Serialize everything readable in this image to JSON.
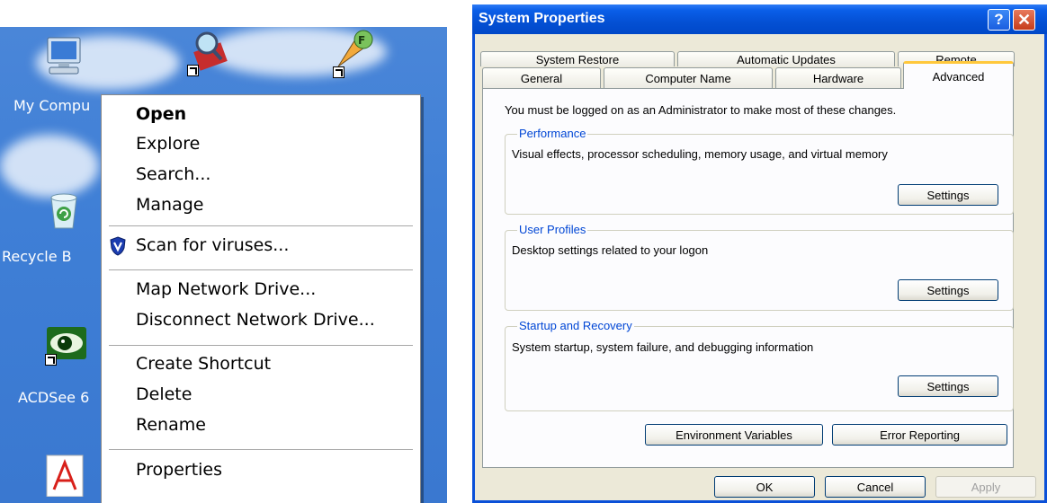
{
  "desktop": {
    "icons": [
      {
        "label": "My Compu",
        "icon": "my-computer-icon"
      },
      {
        "label": "Recycle B",
        "icon": "recycle-bin-icon"
      },
      {
        "label": "ACDSee 6",
        "icon": "acdsee-icon"
      },
      {
        "icon": "acrobat-icon"
      },
      {
        "icon": "search-shortcut-icon"
      },
      {
        "icon": "application-shortcut-icon"
      }
    ]
  },
  "context_menu": {
    "items": [
      {
        "label": "Open"
      },
      {
        "label": "Explore"
      },
      {
        "label": "Search..."
      },
      {
        "label": "Manage"
      },
      {
        "label": "Scan for viruses...",
        "icon": "antivirus-shield-icon"
      },
      {
        "label": "Map Network Drive..."
      },
      {
        "label": "Disconnect Network Drive..."
      },
      {
        "label": "Create Shortcut"
      },
      {
        "label": "Delete"
      },
      {
        "label": "Rename"
      },
      {
        "label": "Properties"
      }
    ]
  },
  "system_properties": {
    "title": "System Properties",
    "help_glyph": "?",
    "close_glyph": "✕",
    "tabs_row1": [
      "System Restore",
      "Automatic Updates",
      "Remote"
    ],
    "tabs_row2": [
      "General",
      "Computer Name",
      "Hardware",
      "Advanced"
    ],
    "active_tab": "Advanced",
    "admin_note": "You must be logged on as an Administrator to make most of these changes.",
    "groups": [
      {
        "title": "Performance",
        "description": "Visual effects, processor scheduling, memory usage, and virtual memory",
        "button": "Settings"
      },
      {
        "title": "User Profiles",
        "description": "Desktop settings related to your logon",
        "button": "Settings"
      },
      {
        "title": "Startup and Recovery",
        "description": "System startup, system failure, and debugging information",
        "button": "Settings"
      }
    ],
    "env_button": "Environment Variables",
    "error_button": "Error Reporting",
    "ok_button": "OK",
    "cancel_button": "Cancel",
    "apply_button": "Apply"
  }
}
